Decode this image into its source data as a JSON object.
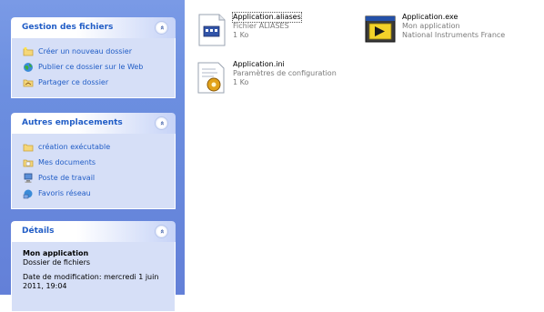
{
  "taskpane": {
    "file_tasks": {
      "title": "Gestion des fichiers",
      "items": [
        {
          "label": "Créer un nouveau dossier",
          "icon": "new-folder-icon"
        },
        {
          "label": "Publier ce dossier sur le Web",
          "icon": "globe-icon"
        },
        {
          "label": "Partager ce dossier",
          "icon": "share-folder-icon"
        }
      ]
    },
    "other_places": {
      "title": "Autres emplacements",
      "items": [
        {
          "label": "création exécutable",
          "icon": "folder-icon"
        },
        {
          "label": "Mes documents",
          "icon": "my-documents-icon"
        },
        {
          "label": "Poste de travail",
          "icon": "computer-icon"
        },
        {
          "label": "Favoris réseau",
          "icon": "network-icon"
        }
      ]
    },
    "details": {
      "title": "Détails",
      "name": "Mon application",
      "type": "Dossier de fichiers",
      "modified_line1": "Date de modification: mercredi 1 juin",
      "modified_line2": "2011, 19:04"
    },
    "collapse_symbol": "«"
  },
  "files": [
    {
      "name": "Application.aliases",
      "type": "Fichier ALIASES",
      "size": "1 Ko",
      "icon": "aliases-file-icon"
    },
    {
      "name": "Application.exe",
      "type": "Mon application",
      "size": "National Instruments France",
      "icon": "labview-exe-icon"
    },
    {
      "name": "Application.ini",
      "type": "Paramètres de configuration",
      "size": "1 Ko",
      "icon": "ini-config-icon"
    }
  ],
  "colors": {
    "pane_blue": "#6c8fe0",
    "link_blue": "#215dc6",
    "panel_body": "#d6dff7"
  }
}
